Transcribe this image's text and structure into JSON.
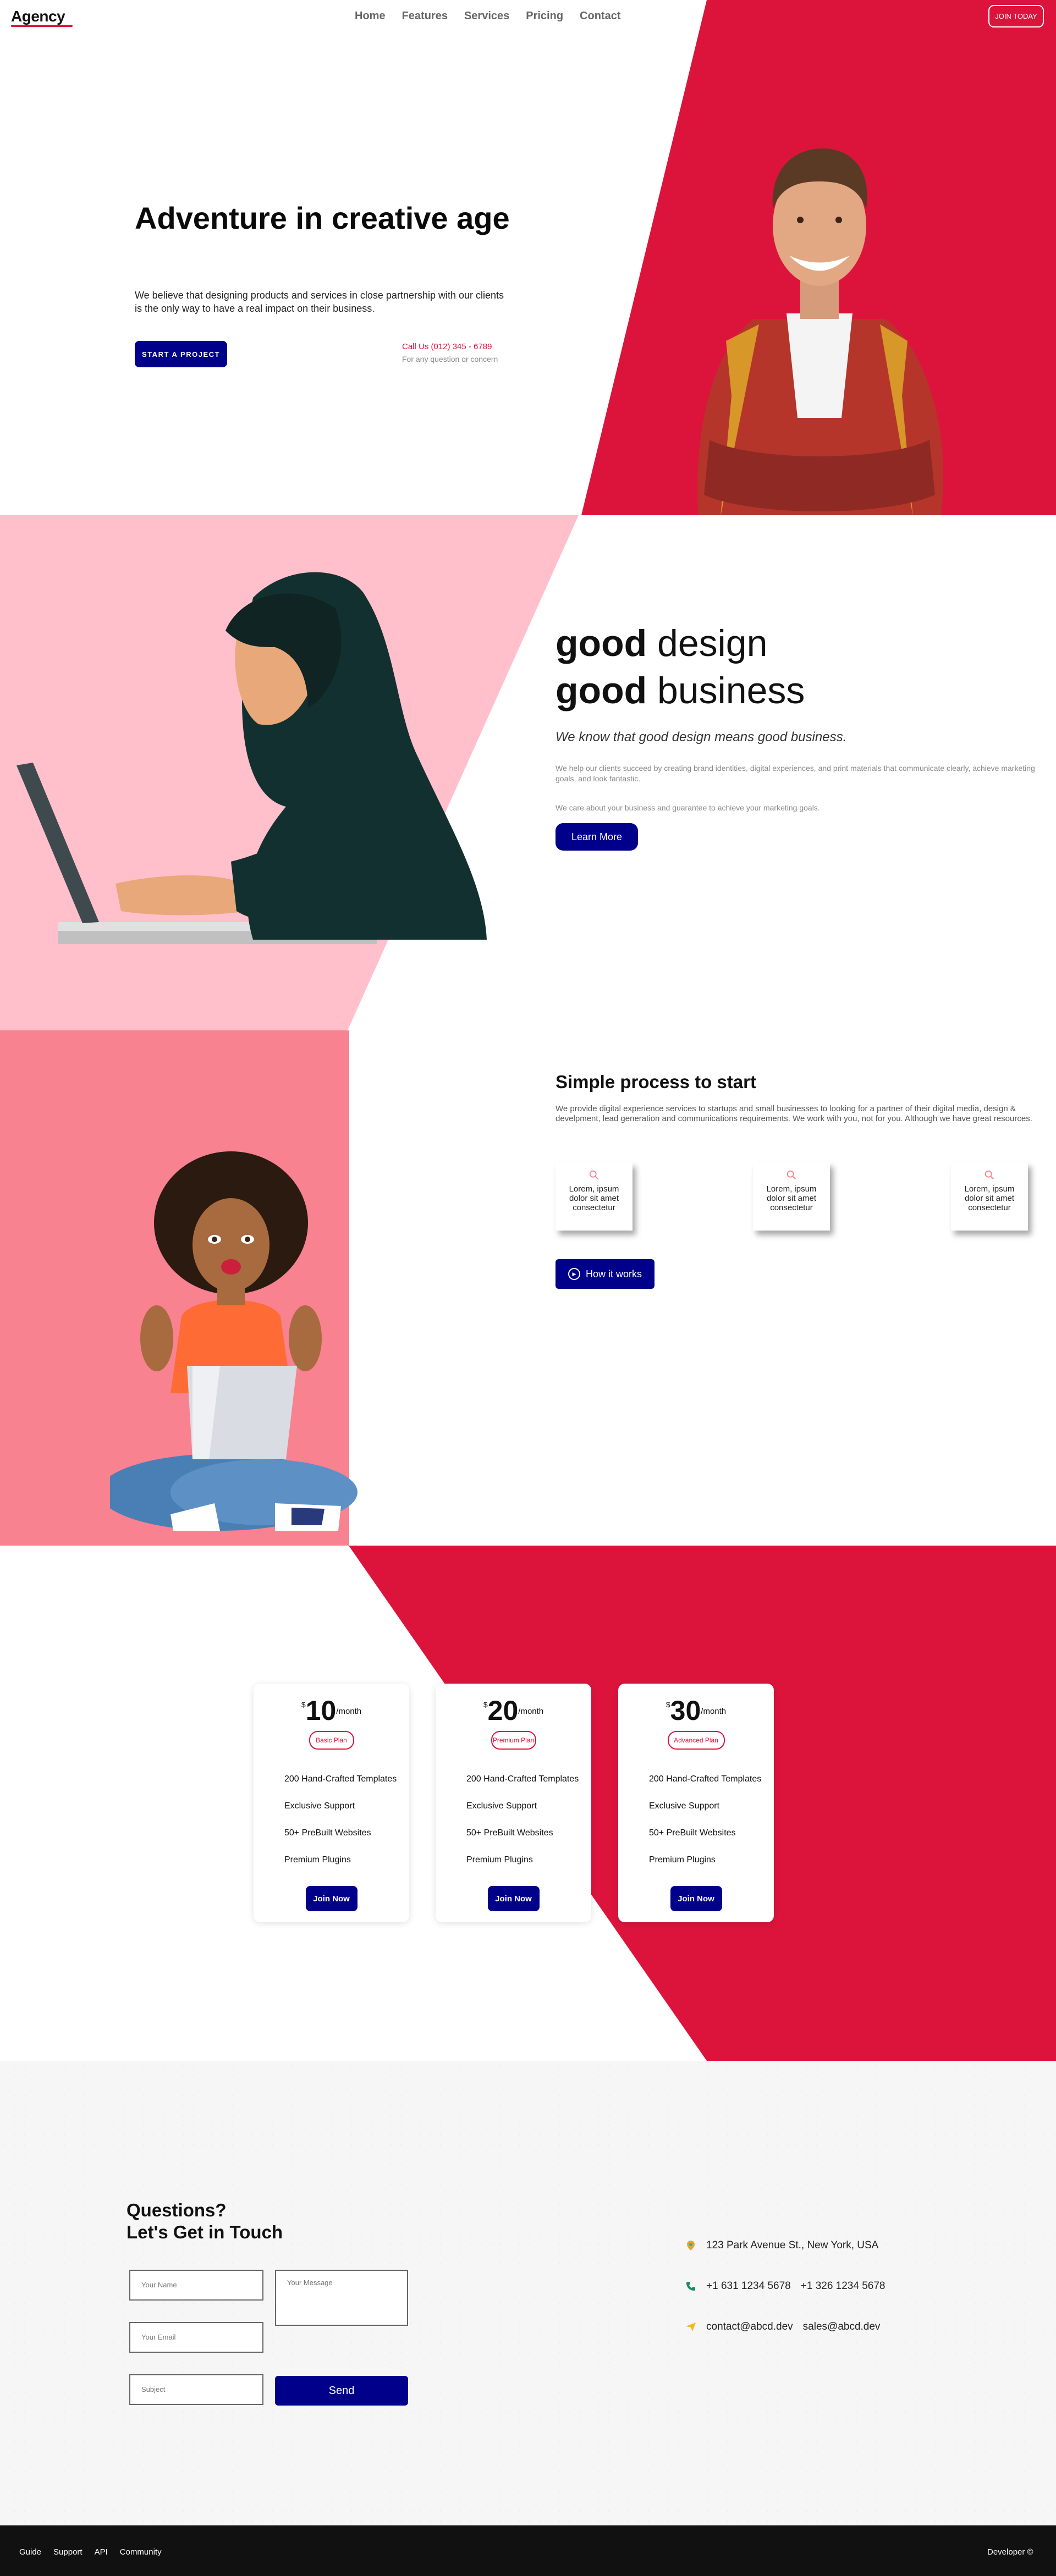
{
  "brand": {
    "logo": "Agency",
    "colors": {
      "accent": "#dc143c",
      "primary": "#00008b",
      "pink_light": "#ffc0cb",
      "pink": "#f8828f",
      "footer": "#111111"
    }
  },
  "nav": {
    "links": [
      "Home",
      "Features",
      "Services",
      "Pricing",
      "Contact"
    ],
    "cta": "JOIN TODAY"
  },
  "hero": {
    "title": "Adventure in creative age",
    "text": "We believe that designing products and services in close partnership with our clients is the only way to have a real impact on their business.",
    "button": "START A PROJECT",
    "phone": "Call Us (012) 345 - 6789",
    "phone_sub": "For any question or concern"
  },
  "good": {
    "line1_bold": "good",
    "line1_rest": " design",
    "line2_bold": "good",
    "line2_rest": " business",
    "subtitle": "We know that good design means good business.",
    "p1": "We help our clients succeed by creating brand identities, digital experiences, and print materials that communicate clearly, achieve marketing goals, and look fantastic.",
    "p2": "We care about your business and guarantee to achieve your marketing goals.",
    "button": "Learn More"
  },
  "process": {
    "title": "Simple process to start",
    "text": "We provide digital experience services to startups and small businesses to looking for a partner of their digital media, design & develpment, lead generation and communications requirements. We work with you, not for you. Although we have great resources.",
    "cards": [
      "Lorem, ipsum dolor sit amet consectetur",
      "Lorem, ipsum dolor sit amet consectetur",
      "Lorem, ipsum dolor sit amet consectetur"
    ],
    "card_icon": "search-icon",
    "button": "How it works"
  },
  "pricing": {
    "plans": [
      {
        "currency": "$",
        "price": "10",
        "period": "/month",
        "name": "Basic Plan",
        "features": [
          "200 Hand-Crafted Templates",
          "Exclusive Support",
          "50+ PreBuilt Websites",
          "Premium Plugins"
        ],
        "button": "Join Now"
      },
      {
        "currency": "$",
        "price": "20",
        "period": "/month",
        "name": "Premium Plan",
        "features": [
          "200 Hand-Crafted Templates",
          "Exclusive Support",
          "50+ PreBuilt Websites",
          "Premium Plugins"
        ],
        "button": "Join Now"
      },
      {
        "currency": "$",
        "price": "30",
        "period": "/month",
        "name": "Advanced Plan",
        "features": [
          "200 Hand-Crafted Templates",
          "Exclusive Support",
          "50+ PreBuilt Websites",
          "Premium Plugins"
        ],
        "button": "Join Now"
      }
    ]
  },
  "contact": {
    "title_line1": "Questions?",
    "title_line2": "Let's Get in Touch",
    "placeholders": {
      "name": "Your Name",
      "email": "Your Email",
      "subject": "Subject",
      "message": "Your Message"
    },
    "button": "Send",
    "address": "123 Park Avenue St., New York, USA",
    "phone1": "+1 631 1234 5678",
    "phone2": "+1 326 1234 5678",
    "email1": "contact@abcd.dev",
    "email2": "sales@abcd.dev"
  },
  "footer": {
    "links": [
      "Guide",
      "Support",
      "API",
      "Community"
    ],
    "right": "Developer ©"
  }
}
